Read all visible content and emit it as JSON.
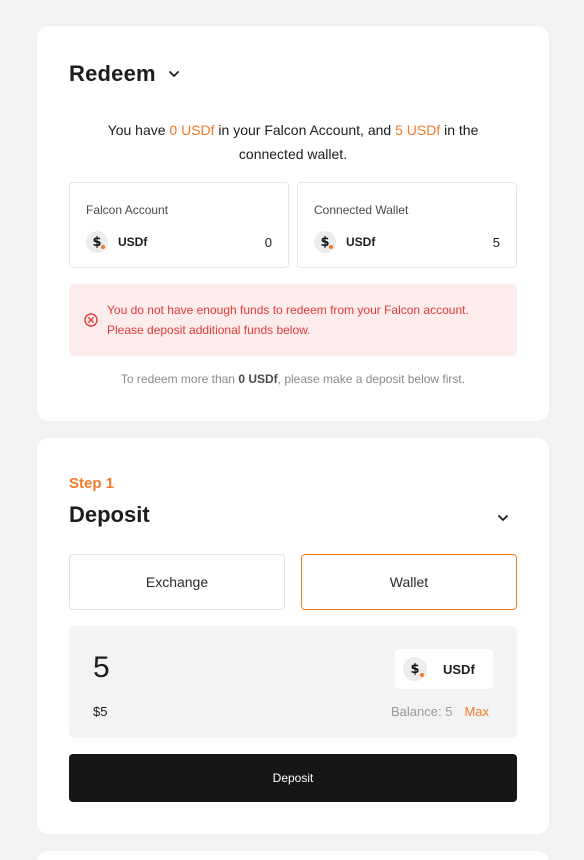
{
  "redeem": {
    "title": "Redeem",
    "summary": {
      "p1": "You have ",
      "amount1": "0 USDf",
      "p2": " in your Falcon Account, and ",
      "amount2": "5 USDf",
      "p3": " in the connected wallet."
    },
    "falcon_account": {
      "label": "Falcon Account",
      "token": "USDf",
      "value": "0"
    },
    "connected_wallet": {
      "label": "Connected Wallet",
      "token": "USDf",
      "value": "5"
    },
    "alert": "You do not have enough funds to redeem from your Falcon account. Please deposit additional funds below.",
    "hint": {
      "p1": "To redeem more than ",
      "bold": "0 USDf",
      "p2": ", please make a deposit below first."
    }
  },
  "deposit": {
    "step": "Step 1",
    "title": "Deposit",
    "tabs": {
      "exchange": "Exchange",
      "wallet": "Wallet",
      "active": "wallet"
    },
    "amount": "5",
    "usd_value": "$5",
    "token": "USDf",
    "balance_label": "Balance: 5",
    "max_label": "Max",
    "button_label": "Deposit"
  },
  "icons": {
    "coin": "dollar-coin-icon",
    "chevron": "chevron-down-icon",
    "alert": "error-circle-icon"
  },
  "colors": {
    "accent": "#f17a28",
    "error": "#e03a3a",
    "error_bg": "#fdecec",
    "button_bg": "#161616",
    "page_bg": "#f2f2f2"
  }
}
